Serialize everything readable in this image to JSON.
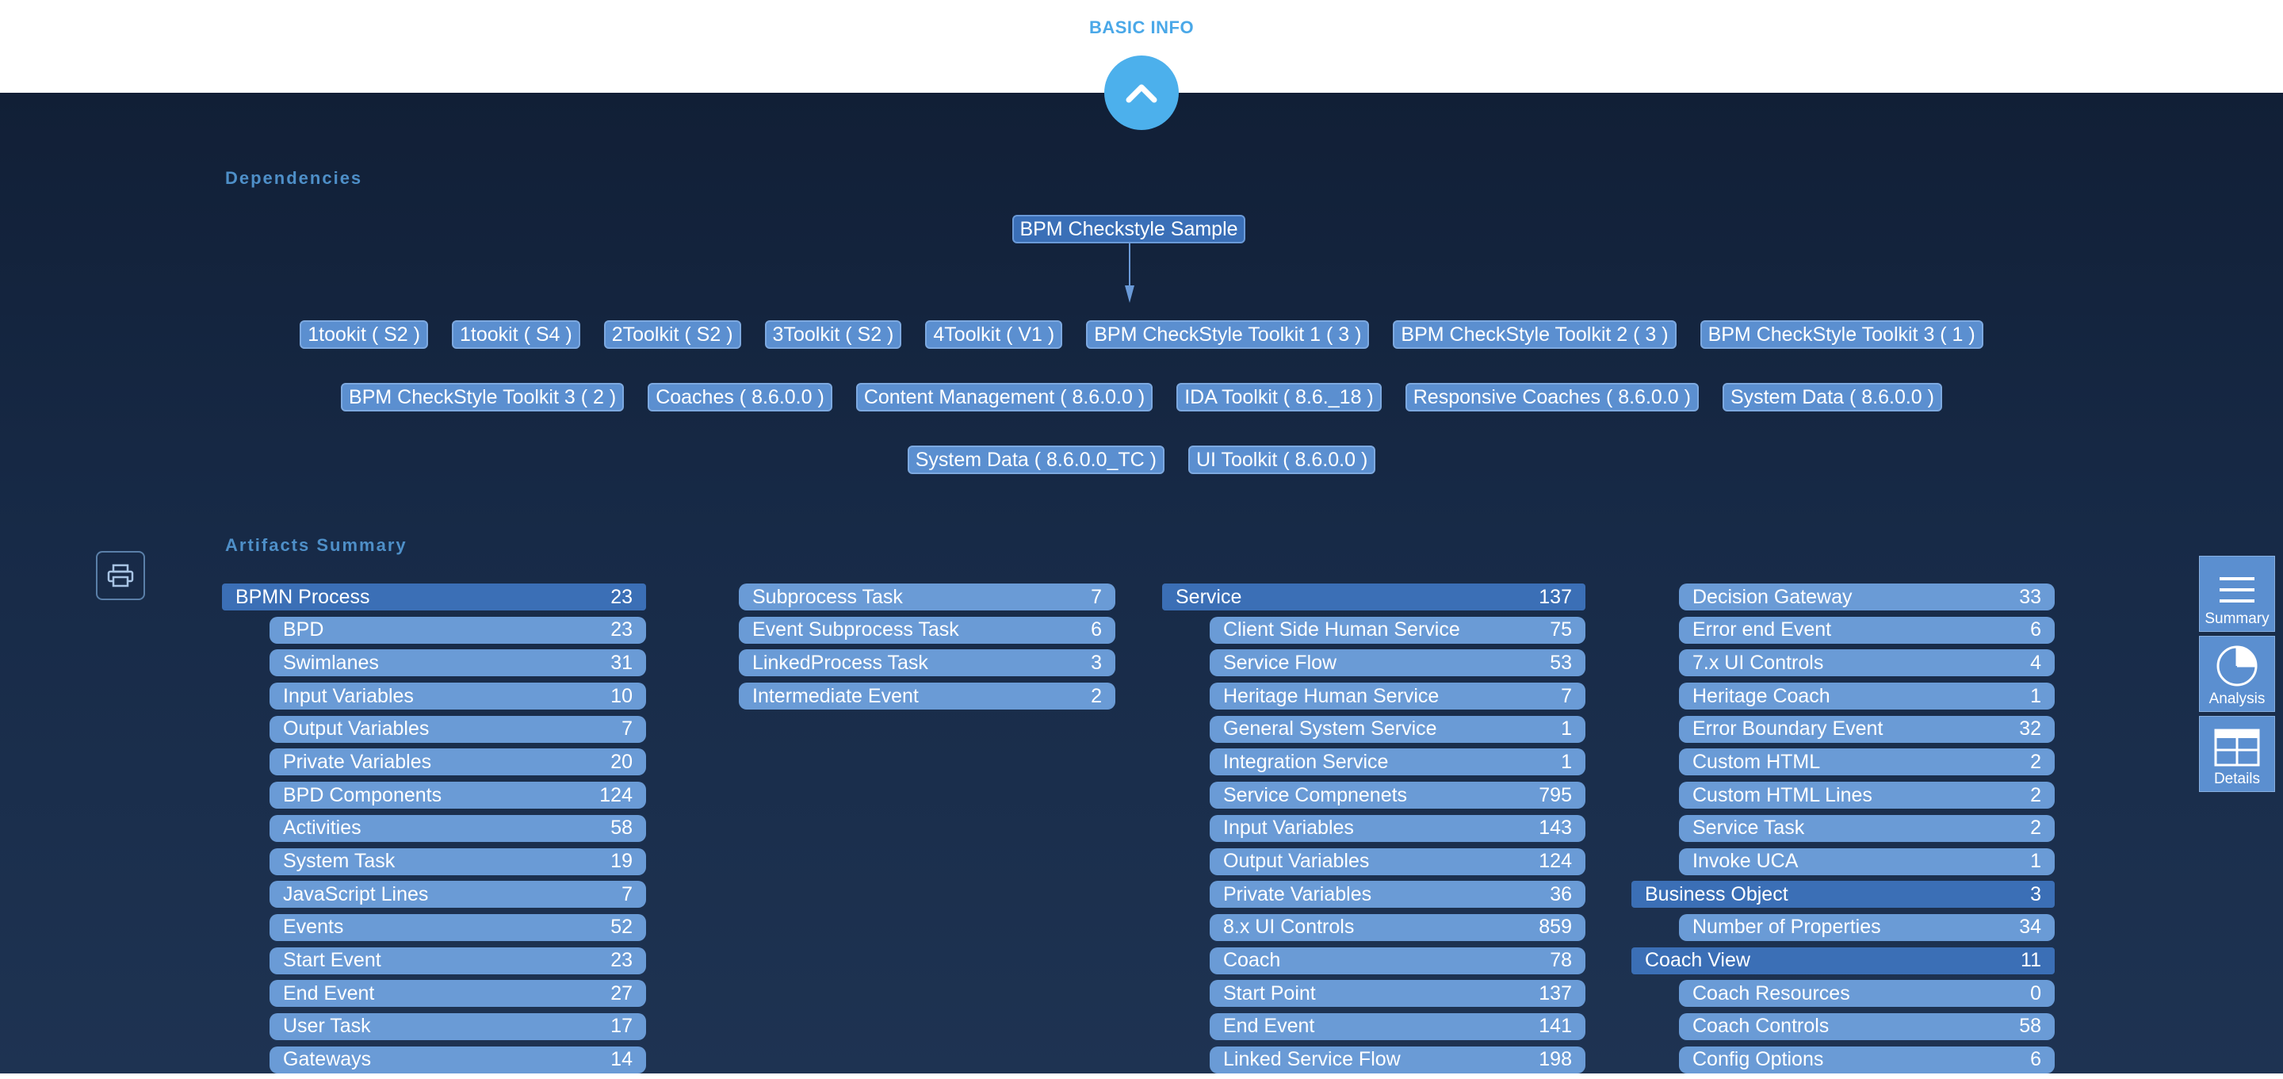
{
  "header": {
    "basic_info": "BASIC INFO"
  },
  "dependencies": {
    "title": "Dependencies",
    "root": "BPM Checkstyle Sample",
    "rows": [
      [
        "1tookit ( S2 )",
        "1tookit ( S4 )",
        "2Toolkit ( S2 )",
        "3Toolkit ( S2 )",
        "4Toolkit ( V1 )",
        "BPM CheckStyle Toolkit 1 ( 3 )",
        "BPM CheckStyle Toolkit 2 ( 3 )",
        "BPM CheckStyle Toolkit 3 ( 1 )"
      ],
      [
        "BPM CheckStyle Toolkit 3 ( 2 )",
        "Coaches ( 8.6.0.0 )",
        "Content Management ( 8.6.0.0 )",
        "IDA Toolkit ( 8.6._18 )",
        "Responsive Coaches ( 8.6.0.0 )",
        "System Data ( 8.6.0.0 )"
      ],
      [
        "System Data ( 8.6.0.0_TC )",
        "UI Toolkit ( 8.6.0.0 )"
      ]
    ]
  },
  "artifacts": {
    "title": "Artifacts Summary",
    "columns": [
      [
        {
          "label": "BPMN Process",
          "value": "23",
          "kind": "header"
        },
        {
          "label": "BPD",
          "value": "23",
          "kind": "item"
        },
        {
          "label": "Swimlanes",
          "value": "31",
          "kind": "item"
        },
        {
          "label": "Input Variables",
          "value": "10",
          "kind": "item"
        },
        {
          "label": "Output Variables",
          "value": "7",
          "kind": "item"
        },
        {
          "label": "Private Variables",
          "value": "20",
          "kind": "item"
        },
        {
          "label": "BPD Components",
          "value": "124",
          "kind": "item"
        },
        {
          "label": "Activities",
          "value": "58",
          "kind": "item"
        },
        {
          "label": "System Task",
          "value": "19",
          "kind": "item"
        },
        {
          "label": "JavaScript Lines",
          "value": "7",
          "kind": "item"
        },
        {
          "label": "Events",
          "value": "52",
          "kind": "item"
        },
        {
          "label": "Start Event",
          "value": "23",
          "kind": "item"
        },
        {
          "label": "End Event",
          "value": "27",
          "kind": "item"
        },
        {
          "label": "User Task",
          "value": "17",
          "kind": "item"
        },
        {
          "label": "Gateways",
          "value": "14",
          "kind": "item"
        }
      ],
      [
        {
          "label": "Subprocess Task",
          "value": "7",
          "kind": "flat"
        },
        {
          "label": "Event Subprocess Task",
          "value": "6",
          "kind": "flat"
        },
        {
          "label": "LinkedProcess Task",
          "value": "3",
          "kind": "flat"
        },
        {
          "label": "Intermediate Event",
          "value": "2",
          "kind": "flat"
        }
      ],
      [
        {
          "label": "Service",
          "value": "137",
          "kind": "header"
        },
        {
          "label": "Client Side Human Service",
          "value": "75",
          "kind": "item"
        },
        {
          "label": "Service Flow",
          "value": "53",
          "kind": "item"
        },
        {
          "label": "Heritage Human Service",
          "value": "7",
          "kind": "item"
        },
        {
          "label": "General System Service",
          "value": "1",
          "kind": "item"
        },
        {
          "label": "Integration Service",
          "value": "1",
          "kind": "item"
        },
        {
          "label": "Service Compnenets",
          "value": "795",
          "kind": "item"
        },
        {
          "label": "Input Variables",
          "value": "143",
          "kind": "item"
        },
        {
          "label": "Output Variables",
          "value": "124",
          "kind": "item"
        },
        {
          "label": "Private Variables",
          "value": "36",
          "kind": "item"
        },
        {
          "label": "8.x UI Controls",
          "value": "859",
          "kind": "item"
        },
        {
          "label": "Coach",
          "value": "78",
          "kind": "item"
        },
        {
          "label": "Start Point",
          "value": "137",
          "kind": "item"
        },
        {
          "label": "End Event",
          "value": "141",
          "kind": "item"
        },
        {
          "label": "Linked Service Flow",
          "value": "198",
          "kind": "item"
        }
      ],
      [
        {
          "label": "Decision Gateway",
          "value": "33",
          "kind": "item"
        },
        {
          "label": "Error end Event",
          "value": "6",
          "kind": "item"
        },
        {
          "label": "7.x UI Controls",
          "value": "4",
          "kind": "item"
        },
        {
          "label": "Heritage Coach",
          "value": "1",
          "kind": "item"
        },
        {
          "label": "Error Boundary Event",
          "value": "32",
          "kind": "item"
        },
        {
          "label": "Custom HTML",
          "value": "2",
          "kind": "item"
        },
        {
          "label": "Custom HTML Lines",
          "value": "2",
          "kind": "item"
        },
        {
          "label": "Service Task",
          "value": "2",
          "kind": "item"
        },
        {
          "label": "Invoke UCA",
          "value": "1",
          "kind": "item"
        },
        {
          "label": "Business Object",
          "value": "3",
          "kind": "header"
        },
        {
          "label": "Number of Properties",
          "value": "34",
          "kind": "item"
        },
        {
          "label": "Coach View",
          "value": "11",
          "kind": "header"
        },
        {
          "label": "Coach Resources",
          "value": "0",
          "kind": "item"
        },
        {
          "label": "Coach Controls",
          "value": "58",
          "kind": "item"
        },
        {
          "label": "Config Options",
          "value": "6",
          "kind": "item"
        }
      ]
    ]
  },
  "side_nav": [
    {
      "label": "Summary",
      "icon": "menu-icon"
    },
    {
      "label": "Analysis",
      "icon": "pie-chart-icon"
    },
    {
      "label": "Details",
      "icon": "table-icon"
    }
  ],
  "colors": {
    "accent": "#4cb0ec",
    "header_row": "#3b6fb6",
    "item_row": "#6a9bd6",
    "background": "#172a47"
  }
}
